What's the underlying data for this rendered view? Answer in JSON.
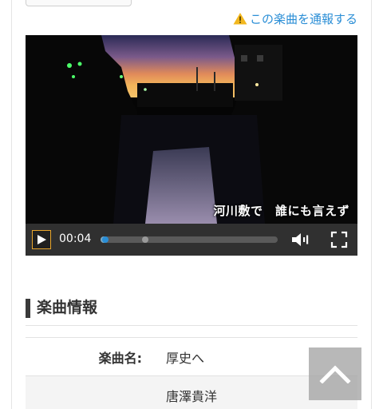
{
  "report_link": {
    "label": "この楽曲を通報する",
    "icon": "warning-icon",
    "icon_color": "#f2b71e",
    "color": "#2a8ed6"
  },
  "player": {
    "subtitle": "河川敷で　誰にも言えず",
    "current_time": "00:04",
    "progress_fraction": 0.02,
    "buffered_fraction": 0.25,
    "accent_color": "#e8a52b",
    "handle_color": "#2a8ed6",
    "controls": {
      "play_icon": "play-icon",
      "volume_icon": "volume-icon",
      "fullscreen_icon": "fullscreen-icon"
    }
  },
  "song_info": {
    "heading": "楽曲情報",
    "rows": [
      {
        "label": "楽曲名:",
        "value": "厚史へ"
      },
      {
        "label": "",
        "value": "唐澤貴洋"
      }
    ]
  },
  "scroll_top": {
    "icon": "chevron-up-icon"
  }
}
